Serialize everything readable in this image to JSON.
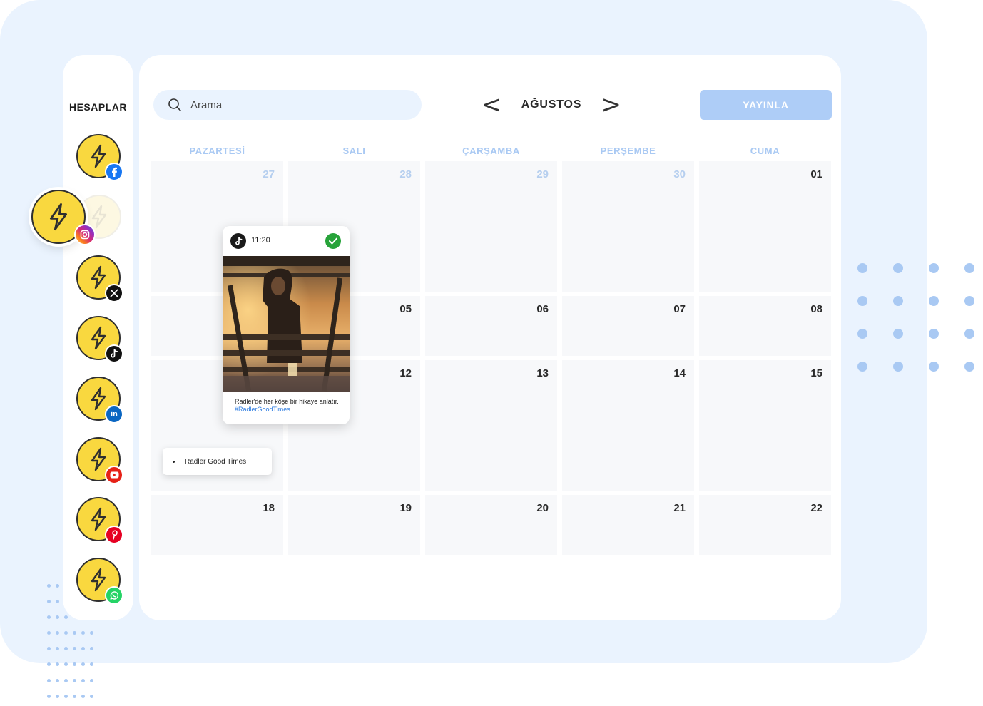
{
  "sidebar": {
    "title": "HESAPLAR",
    "accounts": [
      {
        "platform": "facebook",
        "badge_color": "#1877f2"
      },
      {
        "platform": "instagram",
        "badge_color": "#d62976"
      },
      {
        "platform": "x",
        "badge_color": "#111111"
      },
      {
        "platform": "tiktok",
        "badge_color": "#111111"
      },
      {
        "platform": "linkedin",
        "badge_color": "#0a66c2"
      },
      {
        "platform": "youtube",
        "badge_color": "#e62117"
      },
      {
        "platform": "pinterest",
        "badge_color": "#e60023"
      },
      {
        "platform": "whatsapp",
        "badge_color": "#25d366"
      }
    ]
  },
  "search": {
    "placeholder": "Arama"
  },
  "calendar": {
    "month": "AĞUSTOS",
    "prev_symbol": "<",
    "next_symbol": ">",
    "publish_label": "YAYINLA",
    "weekdays": [
      "PAZARTESİ",
      "SALI",
      "ÇARŞAMBA",
      "PERŞEMBE",
      "CUMA"
    ],
    "weeks": [
      [
        "27",
        "28",
        "29",
        "30",
        "01"
      ],
      [
        "",
        "05",
        "06",
        "07",
        "08"
      ],
      [
        "",
        "12",
        "13",
        "14",
        "15"
      ],
      [
        "18",
        "19",
        "20",
        "21",
        "22"
      ]
    ],
    "muted_days": [
      "27",
      "28",
      "29",
      "30"
    ]
  },
  "post": {
    "time": "11:20",
    "platform": "tiktok",
    "caption": "Radler'de her köşe bir hikaye anlatır.",
    "hashtag": "#RadlerGoodTimes"
  },
  "event": {
    "title": "Radler Good Times"
  },
  "colors": {
    "background": "#eaf3fe",
    "accent_light": "#aecdf7",
    "account_yellow": "#f9d83f",
    "muted_text": "#a9c9f3"
  }
}
